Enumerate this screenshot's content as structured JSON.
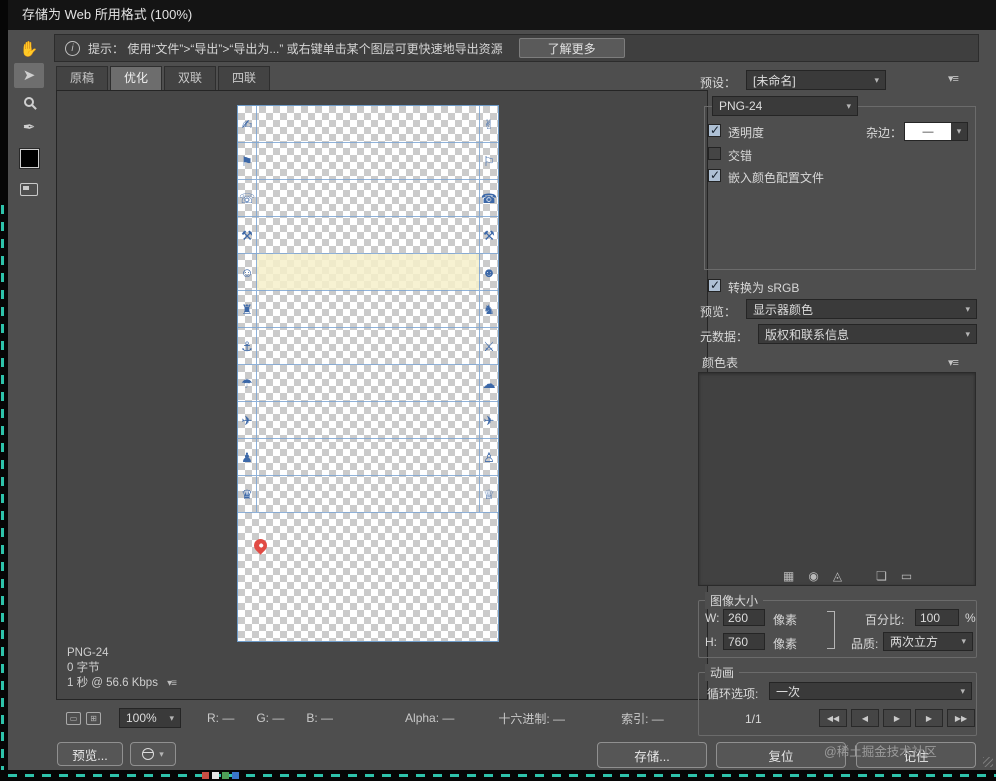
{
  "window": {
    "title": "存储为 Web 所用格式 (100%)"
  },
  "info_bar": {
    "tip": "提示： 使用“文件”>“导出”>“导出为...” 或右键单击某个图层可更快速地导出资源",
    "learn_more_label": "了解更多"
  },
  "icons": {
    "panel_menu": "▾≡"
  },
  "toolbar": {
    "tools": [
      {
        "name": "hand-tool",
        "glyph": "✋"
      },
      {
        "name": "slice-select-tool",
        "glyph": "➤",
        "active": true
      },
      {
        "name": "zoom-tool",
        "glyph": ""
      },
      {
        "name": "eyedropper-tool",
        "glyph": "✒"
      },
      {
        "name": "eyedropper-color-swatch",
        "glyph": ""
      },
      {
        "name": "toggle-slices-visibility",
        "glyph": ""
      }
    ]
  },
  "tabs": [
    {
      "label": "原稿",
      "active": false
    },
    {
      "label": "优化",
      "active": true
    },
    {
      "label": "双联",
      "active": false
    },
    {
      "label": "四联",
      "active": false
    }
  ],
  "canvas": {
    "slices": {
      "rows": [
        {
          "left": "✍",
          "right": "✌"
        },
        {
          "left": "⚑",
          "right": "⚐"
        },
        {
          "left": "☏",
          "right": "☎"
        },
        {
          "left": "⚒",
          "right": "⚒"
        },
        {
          "left": "☺",
          "right": "☻",
          "highlight": true
        },
        {
          "left": "♜",
          "right": "♞"
        },
        {
          "left": "⚓",
          "right": "⚔"
        },
        {
          "left": "☂",
          "right": "☁"
        },
        {
          "left": "✈",
          "right": "✈"
        },
        {
          "left": "♟",
          "right": "♙"
        },
        {
          "left": "♛",
          "right": "♕"
        }
      ]
    },
    "format_info": {
      "format": "PNG-24",
      "size": "0 字节",
      "time": "1 秒 @ 56.6 Kbps"
    }
  },
  "status_bar": {
    "zoom": "100%",
    "readouts": [
      "R: —",
      "G: —",
      "B: —",
      "Alpha: —",
      "十六进制: —",
      "索引: —"
    ]
  },
  "footer": {
    "preview_label": "预览...",
    "save_label": "存储...",
    "reset_label": "复位",
    "remember_label": "记住",
    "watermark": "@稀土掘金技术社区"
  },
  "panel": {
    "preset": {
      "label": "预设：",
      "value": "[未命名]"
    },
    "format": {
      "value": "PNG-24"
    },
    "options": {
      "transparency": {
        "label": "透明度",
        "checked": true
      },
      "matte": {
        "label": "杂边：",
        "value": "—"
      },
      "interlaced": {
        "label": "交错",
        "checked": false
      },
      "embed_profile": {
        "label": "嵌入颜色配置文件",
        "checked": true
      },
      "convert_srgb": {
        "label": "转换为 sRGB",
        "checked": true
      }
    },
    "preview": {
      "label": "预览：",
      "value": "显示器颜色"
    },
    "metadata": {
      "label": "元数据：",
      "value": "版权和联系信息"
    },
    "color_table": {
      "label": "颜色表",
      "icons": [
        {
          "name": "map-transparency-icon",
          "glyph": "▦"
        },
        {
          "name": "shift-web-safe-icon",
          "glyph": "◉"
        },
        {
          "name": "lock-color-icon",
          "glyph": "◬"
        },
        {
          "name": "new-color-icon",
          "glyph": "❏"
        },
        {
          "name": "delete-color-icon",
          "glyph": "▭"
        }
      ]
    },
    "image_size": {
      "label": "图像大小",
      "w_label": "W:",
      "w_value": "260",
      "w_unit": "像素",
      "h_label": "H:",
      "h_value": "760",
      "h_unit": "像素",
      "percent_label": "百分比:",
      "percent_value": "100",
      "percent_unit": "%",
      "quality_label": "品质:",
      "quality_value": "两次立方"
    },
    "animation": {
      "label": "动画",
      "loop_label": "循环选项:",
      "loop_value": "一次",
      "frame_indicator": "1/1",
      "transport": [
        {
          "name": "first-frame-button",
          "glyph": "◀◀"
        },
        {
          "name": "previous-frame-button",
          "glyph": "◀"
        },
        {
          "name": "play-button",
          "glyph": "▶"
        },
        {
          "name": "next-frame-button",
          "glyph": "▶"
        },
        {
          "name": "last-frame-button",
          "glyph": "▶▶"
        }
      ]
    }
  }
}
